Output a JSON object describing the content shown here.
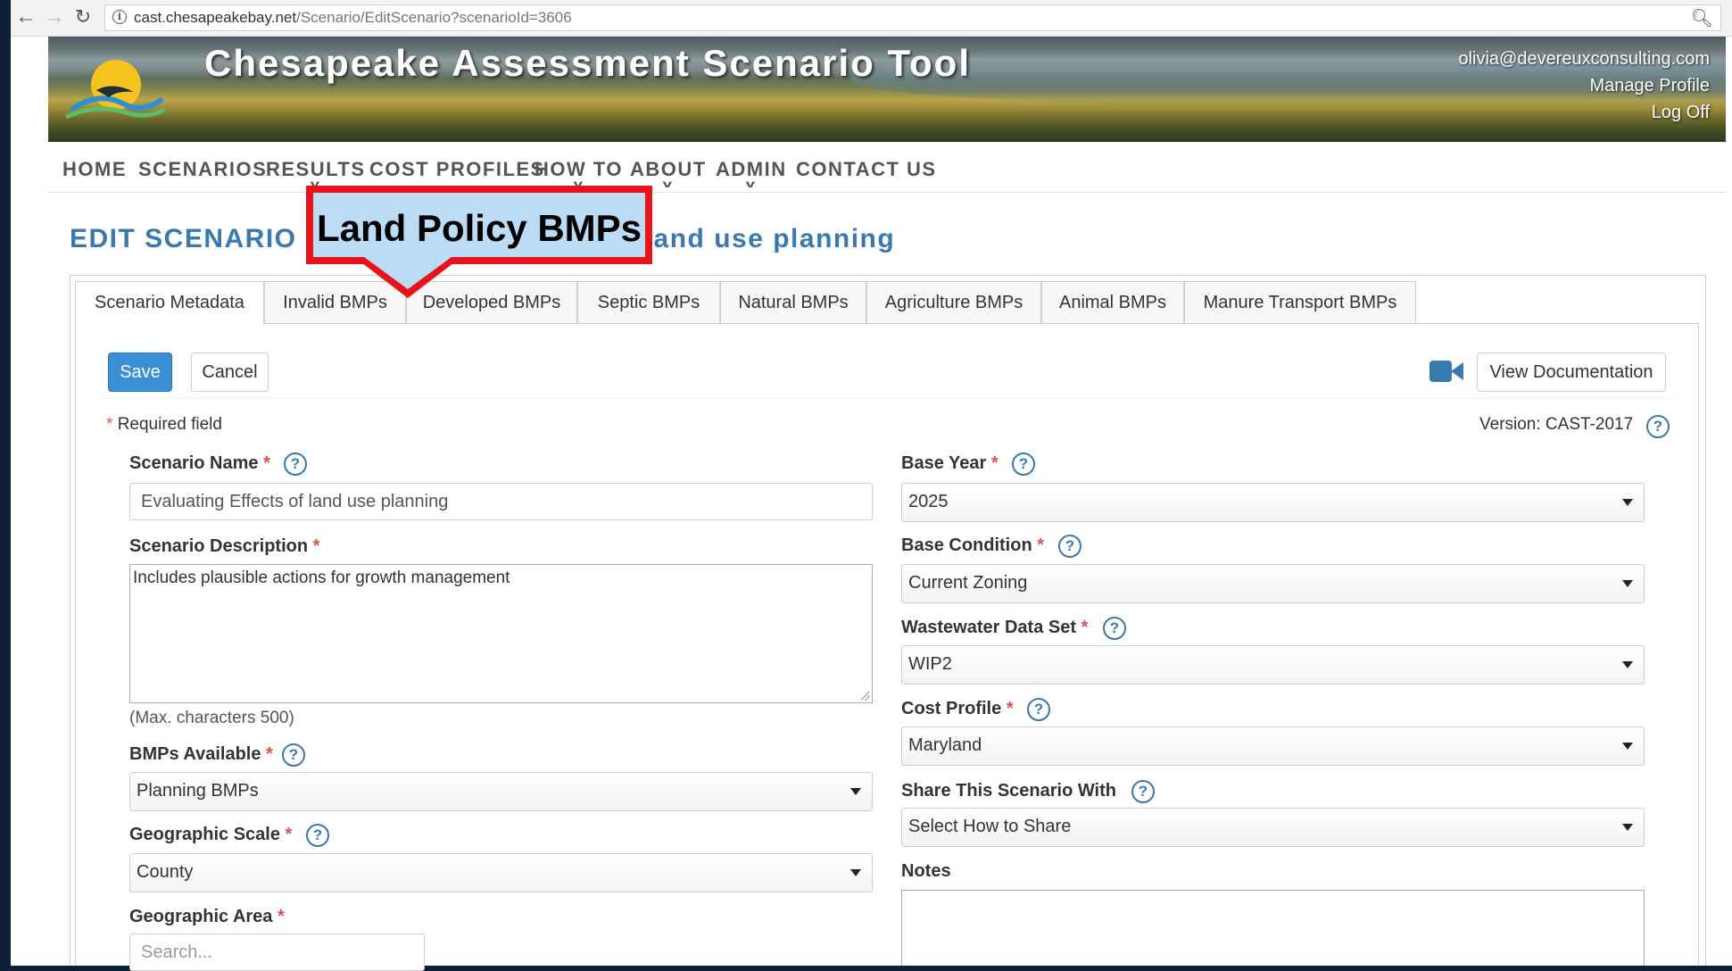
{
  "browser": {
    "url_domain": "cast.chesapeakebay.net",
    "url_path": "/Scenario/EditScenario?scenarioId=3606"
  },
  "header": {
    "site_title": "Chesapeake Assessment Scenario Tool",
    "user_email": "olivia@devereuxconsulting.com",
    "manage_profile": "Manage Profile",
    "log_off": "Log Off"
  },
  "nav": {
    "home": "HOME",
    "scenarios": "SCENARIOS",
    "results": "RESULTS",
    "cost_profiles": "COST PROFILES",
    "how_to": "HOW TO",
    "about": "ABOUT",
    "admin": "ADMIN",
    "contact_us": "CONTACT US"
  },
  "page": {
    "heading_left": "EDIT SCENARIO",
    "heading_right": "and use planning"
  },
  "callout": {
    "text": "Land Policy BMPs"
  },
  "tabs": [
    {
      "label": "Scenario Metadata"
    },
    {
      "label": "Invalid BMPs"
    },
    {
      "label": "Developed BMPs"
    },
    {
      "label": "Septic BMPs"
    },
    {
      "label": "Natural BMPs"
    },
    {
      "label": "Agriculture BMPs"
    },
    {
      "label": "Animal BMPs"
    },
    {
      "label": "Manure Transport BMPs"
    }
  ],
  "toolbar": {
    "save_label": "Save",
    "cancel_label": "Cancel",
    "doc_label": "View Documentation"
  },
  "form": {
    "required_marker": "*",
    "required_note": "Required field",
    "version": "Version: CAST-2017",
    "scenario_name_label": "Scenario Name",
    "scenario_name_value": "Evaluating Effects of land use planning",
    "scenario_desc_label": "Scenario Description",
    "scenario_desc_value": "Includes plausible actions for growth management",
    "max_chars": "(Max. characters 500)",
    "bmps_available_label": "BMPs Available",
    "bmps_available_value": "Planning BMPs",
    "geo_scale_label": "Geographic Scale",
    "geo_scale_value": "County",
    "geo_area_label": "Geographic Area",
    "geo_area_placeholder": "Search...",
    "base_year_label": "Base Year",
    "base_year_value": "2025",
    "base_condition_label": "Base Condition",
    "base_condition_value": "Current Zoning",
    "wastewater_label": "Wastewater Data Set",
    "wastewater_value": "WIP2",
    "cost_profile_label": "Cost Profile",
    "cost_profile_value": "Maryland",
    "share_label": "Share This Scenario With",
    "share_value": "Select How to Share",
    "notes_label": "Notes",
    "help_glyph": "?"
  },
  "colors": {
    "heading_blue": "#3a78b0",
    "save_blue": "#3b8fd7",
    "callout_fill": "#bcdcf6",
    "callout_border": "#e8141b",
    "required_red": "#d9534f"
  },
  "icons": {
    "back": "back-arrow-icon",
    "forward": "forward-arrow-icon",
    "reload": "reload-icon",
    "info": "info-icon",
    "zoom": "zoom-icon",
    "video": "video-camera-icon",
    "help": "help-icon",
    "dropdown": "dropdown-arrow-icon"
  }
}
